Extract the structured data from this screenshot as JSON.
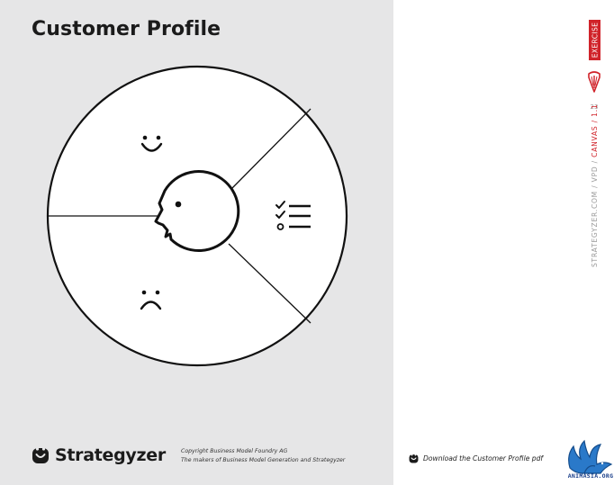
{
  "page": {
    "title": "Customer Profile"
  },
  "canvas": {
    "segments": [
      {
        "name": "gains",
        "icon": "smile-icon"
      },
      {
        "name": "pains",
        "icon": "frown-icon"
      },
      {
        "name": "jobs",
        "icon": "checklist-icon"
      }
    ],
    "center_icon": "face-profile-icon"
  },
  "footer": {
    "brand_name": "Strategyzer",
    "copyright_line1": "Copyright Business Model Foundry AG",
    "copyright_line2": "The makers of Business Model Generation and Strategyzer"
  },
  "sidebar": {
    "label": "EXERCISE",
    "page_number": "23",
    "path_prefix": "STRATEGYZER.COM / VPD / ",
    "path_accent": "CANVAS / 1.1"
  },
  "download": {
    "label": "Download the Customer Profile pdf"
  },
  "watermark": {
    "text": "ANIMASIA.ORG"
  },
  "colors": {
    "accent": "#d0232a",
    "panel": "#e6e6e7",
    "ink": "#1b1b1b"
  }
}
